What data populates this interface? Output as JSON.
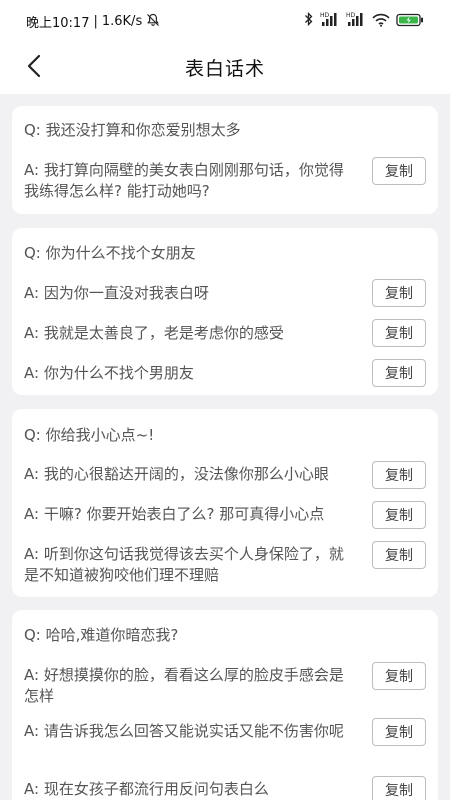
{
  "status": {
    "time": "晚上10:17",
    "speed": "1.6K/s",
    "hd_label": "HD",
    "battery_label": "⚡"
  },
  "nav": {
    "title": "表白话术"
  },
  "copy_label": "复制",
  "cards": [
    {
      "question": "Q: 我还没打算和你恋爱别想太多",
      "answers": [
        "A: 我打算向隔壁的美女表白刚刚那句话，你觉得我练得怎么样? 能打动她吗?"
      ]
    },
    {
      "question": "Q: 你为什么不找个女朋友",
      "answers": [
        "A: 因为你一直没对我表白呀",
        "A: 我就是太善良了，老是考虑你的感受",
        "A: 你为什么不找个男朋友"
      ]
    },
    {
      "question": "Q: 你给我小心点~!",
      "answers": [
        "A: 我的心很豁达开阔的，没法像你那么小心眼",
        "A: 干嘛? 你要开始表白了么? 那可真得小心点",
        "A: 听到你这句话我觉得该去买个人身保险了，就是不知道被狗咬他们理不理赔"
      ]
    },
    {
      "question": "Q: 哈哈,难道你暗恋我?",
      "answers": [
        "A: 好想摸摸你的脸，看看这么厚的脸皮手感会是怎样",
        "A: 请告诉我怎么回答又能说实话又能不伤害你呢",
        "A: 现在女孩子都流行用反问句表白么"
      ]
    }
  ]
}
